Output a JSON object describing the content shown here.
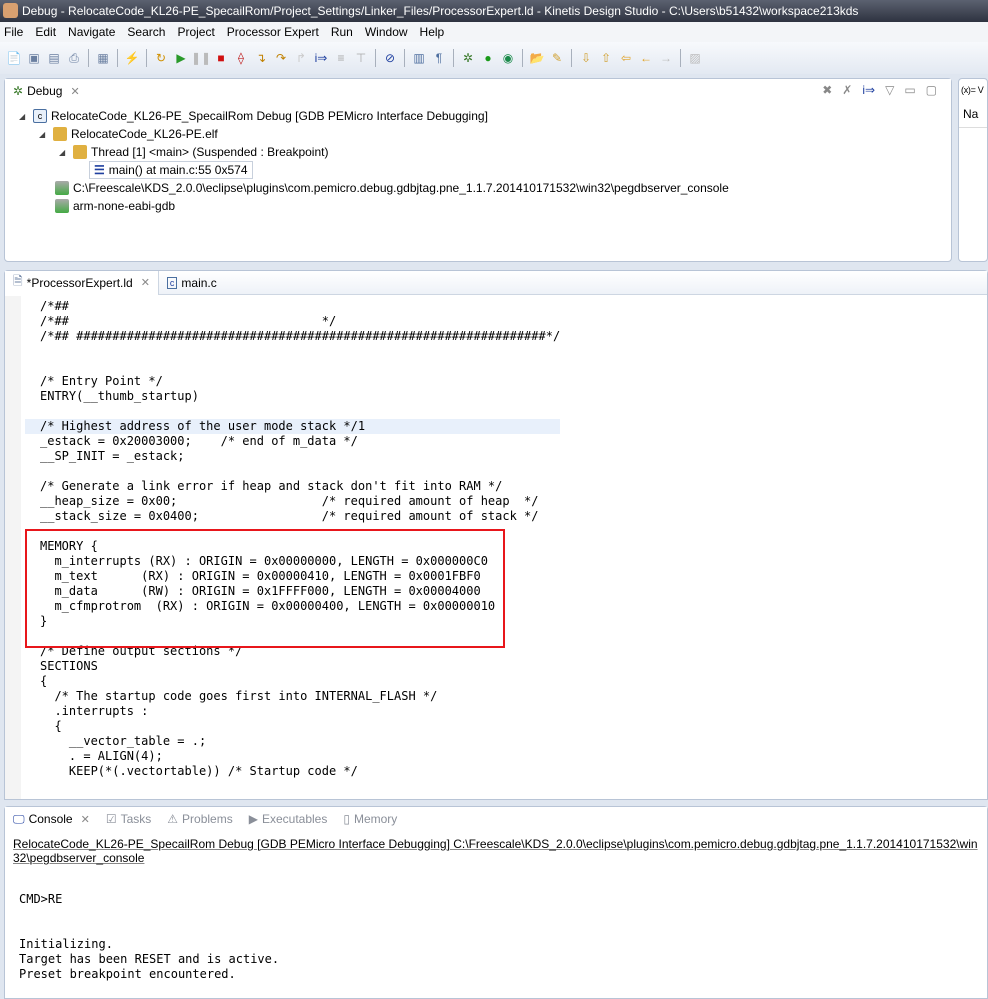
{
  "window": {
    "title": "Debug - RelocateCode_KL26-PE_SpecailRom/Project_Settings/Linker_Files/ProcessorExpert.ld - Kinetis Design Studio - C:\\Users\\b51432\\workspace213kds"
  },
  "menu": [
    "File",
    "Edit",
    "Navigate",
    "Search",
    "Project",
    "Processor Expert",
    "Run",
    "Window",
    "Help"
  ],
  "debug": {
    "tab": "Debug",
    "tree": [
      "RelocateCode_KL26-PE_SpecailRom Debug [GDB PEMicro Interface Debugging]",
      "RelocateCode_KL26-PE.elf",
      "Thread [1] <main> (Suspended : Breakpoint)",
      "main() at main.c:55 0x574",
      "C:\\Freescale\\KDS_2.0.0\\eclipse\\plugins\\com.pemicro.debug.gdbjtag.pne_1.1.7.201410171532\\win32\\pegdbserver_console",
      "arm-none-eabi-gdb"
    ]
  },
  "variables": {
    "tab": "(x)= V",
    "column": "Na"
  },
  "editor": {
    "tabs": [
      "*ProcessorExpert.ld",
      "main.c"
    ],
    "lines": [
      "/*##",
      "/*##                                   */",
      "/*## #################################################################*/",
      "",
      "",
      "/* Entry Point */",
      "ENTRY(__thumb_startup)",
      "",
      "/* Highest address of the user mode stack */1",
      "_estack = 0x20003000;    /* end of m_data */",
      "__SP_INIT = _estack;",
      "",
      "/* Generate a link error if heap and stack don't fit into RAM */",
      "__heap_size = 0x00;                    /* required amount of heap  */",
      "__stack_size = 0x0400;                 /* required amount of stack */",
      "",
      "MEMORY {",
      "  m_interrupts (RX) : ORIGIN = 0x00000000, LENGTH = 0x000000C0",
      "  m_text      (RX) : ORIGIN = 0x00000410, LENGTH = 0x0001FBF0",
      "  m_data      (RW) : ORIGIN = 0x1FFFF000, LENGTH = 0x00004000",
      "  m_cfmprotrom  (RX) : ORIGIN = 0x00000400, LENGTH = 0x00000010",
      "}",
      "",
      "/* Define output sections */",
      "SECTIONS",
      "{",
      "  /* The startup code goes first into INTERNAL_FLASH */",
      "  .interrupts :",
      "  {",
      "    __vector_table = .;",
      "    . = ALIGN(4);",
      "    KEEP(*(.vectortable)) /* Startup code */"
    ]
  },
  "console": {
    "tabs": [
      "Console",
      "Tasks",
      "Problems",
      "Executables",
      "Memory"
    ],
    "header": "RelocateCode_KL26-PE_SpecailRom Debug [GDB PEMicro Interface Debugging] C:\\Freescale\\KDS_2.0.0\\eclipse\\plugins\\com.pemicro.debug.gdbjtag.pne_1.1.7.201410171532\\win32\\pegdbserver_console",
    "lines": [
      "",
      "CMD>RE",
      "",
      "",
      "Initializing.",
      "Target has been RESET and is active.",
      "Preset breakpoint encountered."
    ]
  },
  "colors": {
    "highlight_box": "#e8161b"
  }
}
